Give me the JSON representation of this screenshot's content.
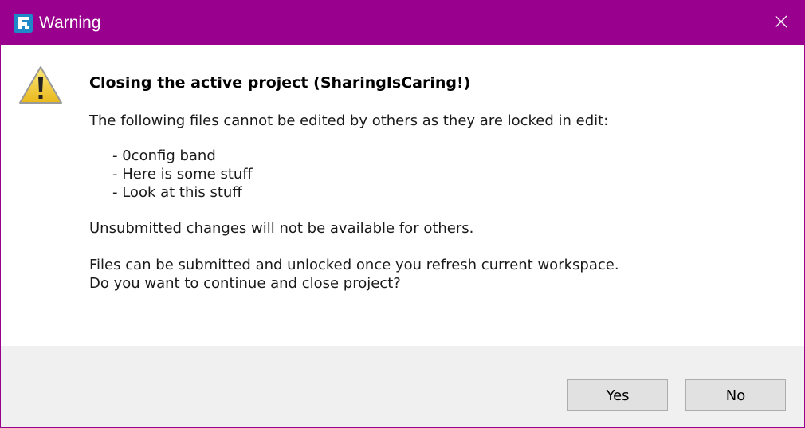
{
  "window": {
    "title": "Warning",
    "accent_color": "#99008e",
    "app_icon": "app-logo-icon",
    "close_icon": "close-icon"
  },
  "message": {
    "icon": "warning-icon",
    "heading": "Closing the active project (SharingIsCaring!)",
    "intro": "The following files cannot be edited by others as they are locked in edit:",
    "files": [
      "- 0config band",
      "- Here is some stuff",
      "- Look at this stuff"
    ],
    "note": "Unsubmitted changes will not be available for others.",
    "info": "Files can be submitted and unlocked once you refresh current workspace.",
    "question": "Do you want to continue and close project?"
  },
  "buttons": {
    "yes_label": "Yes",
    "no_label": "No"
  }
}
